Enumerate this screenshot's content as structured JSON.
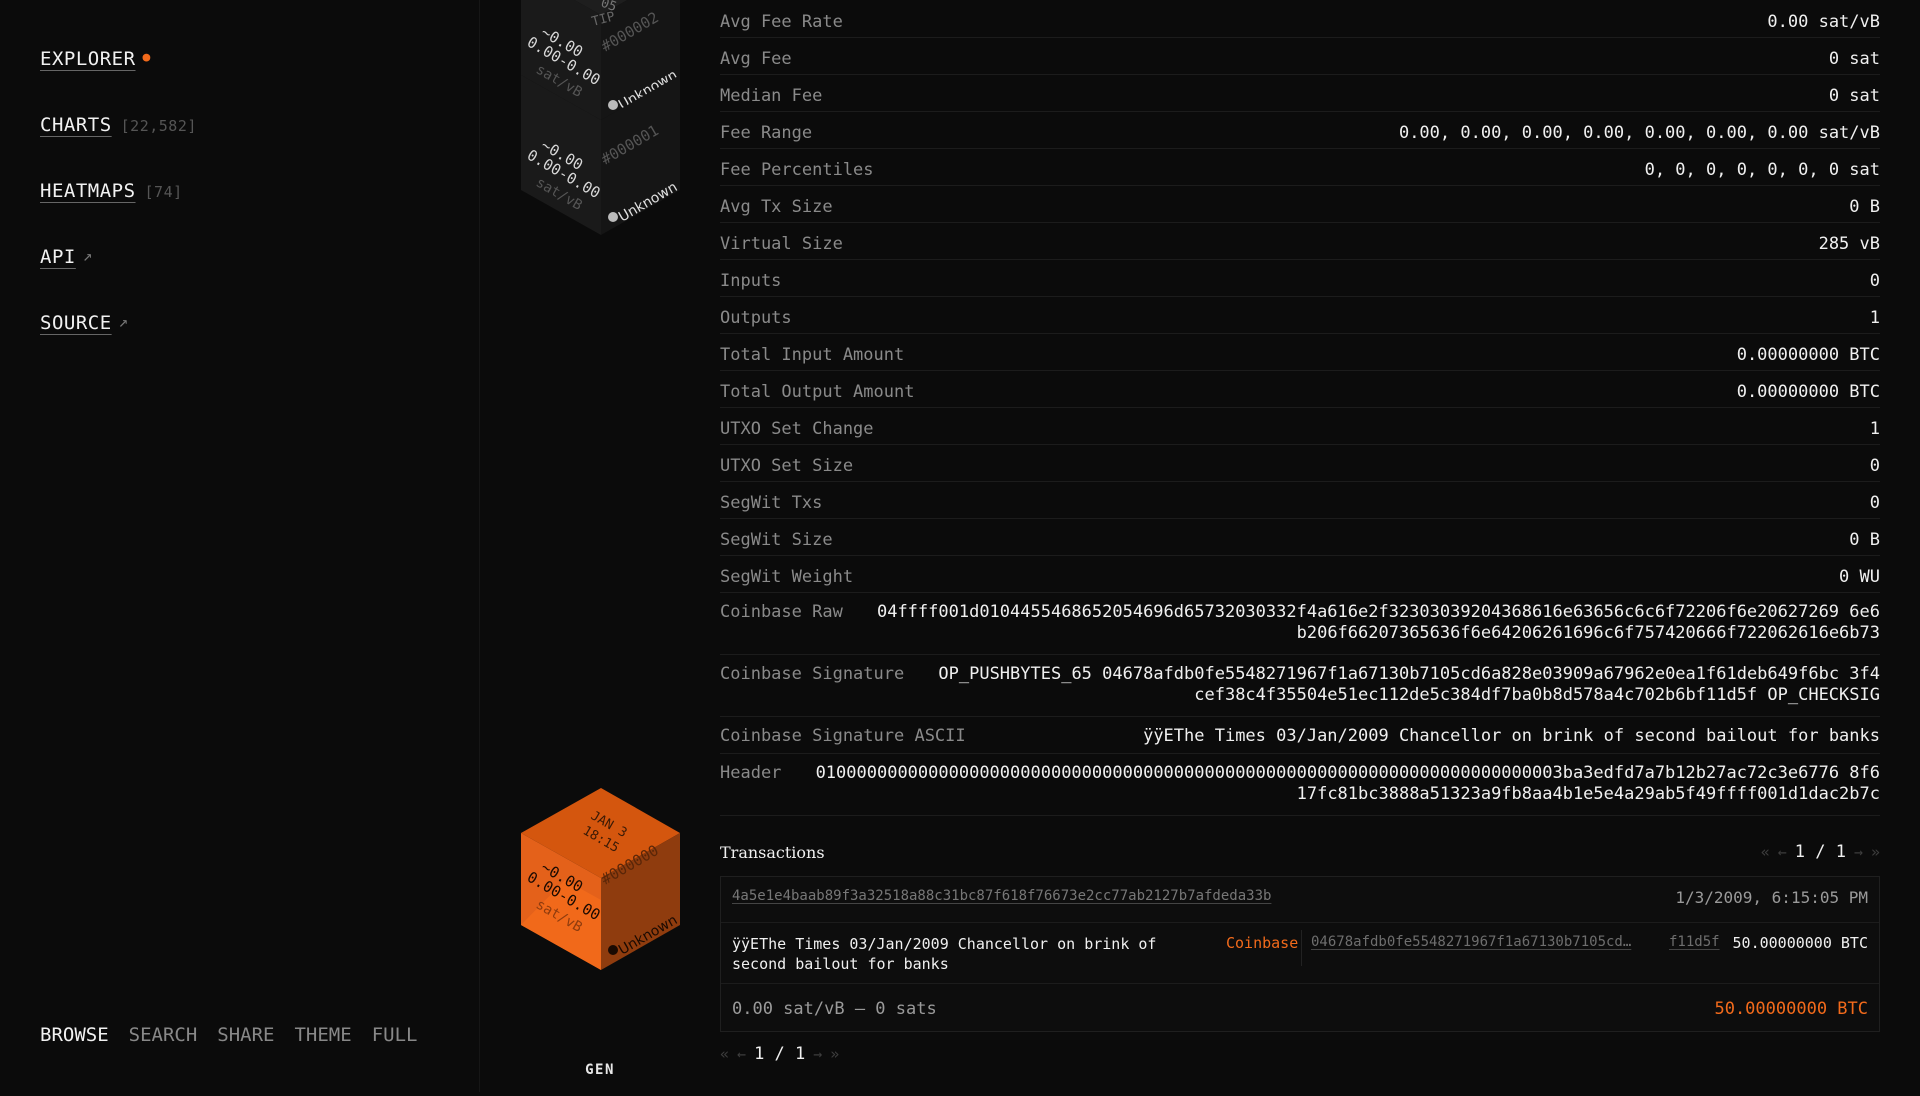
{
  "sidebar": {
    "nav": [
      {
        "label": "EXPLORER",
        "count": "",
        "marker": "dot"
      },
      {
        "label": "CHARTS",
        "count": "[22,582]",
        "marker": ""
      },
      {
        "label": "HEATMAPS",
        "count": "[74]",
        "marker": ""
      },
      {
        "label": "API",
        "count": "",
        "marker": "↗"
      },
      {
        "label": "SOURCE",
        "count": "",
        "marker": "↗"
      }
    ],
    "footer": [
      "BROWSE",
      "SEARCH",
      "SHARE",
      "THEME",
      "FULL"
    ],
    "active_color": "#f26a1b"
  },
  "blocks": {
    "top_cube_1": {
      "tip": "TIP",
      "number": "#000002",
      "fee1": "~0.00",
      "fee2": "0.00-0.00",
      "unit": "sat/vB",
      "miner": "Unknown",
      "partial": "05"
    },
    "top_cube_2": {
      "number": "#000001",
      "fee1": "~0.00",
      "fee2": "0.00-0.00",
      "unit": "sat/vB",
      "miner": "Unknown"
    },
    "genesis": {
      "date": "JAN 3",
      "time": "18:15",
      "number": "#000000",
      "fee1": "~0.00",
      "fee2": "0.00-0.00",
      "unit": "sat/vB",
      "miner": "Unknown"
    },
    "gen_label": "GEN",
    "accent": "#f26a1b"
  },
  "details": [
    {
      "k": "Avg Fee Rate",
      "v": "0.00 sat/vB"
    },
    {
      "k": "Avg Fee",
      "v": "0 sat"
    },
    {
      "k": "Median Fee",
      "v": "0 sat"
    },
    {
      "k": "Fee Range",
      "v": "0.00, 0.00, 0.00, 0.00, 0.00, 0.00, 0.00 sat/vB"
    },
    {
      "k": "Fee Percentiles",
      "v": "0, 0, 0, 0, 0, 0, 0 sat"
    },
    {
      "k": "Avg Tx Size",
      "v": "0 B"
    },
    {
      "k": "Virtual Size",
      "v": "285 vB"
    },
    {
      "k": "Inputs",
      "v": "0"
    },
    {
      "k": "Outputs",
      "v": "1"
    },
    {
      "k": "Total Input Amount",
      "v": "0.00000000 BTC"
    },
    {
      "k": "Total Output Amount",
      "v": "0.00000000 BTC"
    },
    {
      "k": "UTXO Set Change",
      "v": "1"
    },
    {
      "k": "UTXO Set Size",
      "v": "0"
    },
    {
      "k": "SegWit Txs",
      "v": "0"
    },
    {
      "k": "SegWit Size",
      "v": "0 B"
    },
    {
      "k": "SegWit Weight",
      "v": "0 WU"
    },
    {
      "k": "Coinbase Raw",
      "v": "04ffff001d0104455468652054696d65732030332f4a616e2f32303039204368616e63656c6c6f72206f6e20627269 6e6b206f66207365636f6e64206261696c6f757420666f722062616e6b73"
    },
    {
      "k": "Coinbase Signature",
      "v": "OP_PUSHBYTES_65 04678afdb0fe5548271967f1a67130b7105cd6a828e03909a67962e0ea1f61deb649f6bc 3f4cef38c4f35504e51ec112de5c384df7ba0b8d578a4c702b6bf11d5f OP_CHECKSIG"
    },
    {
      "k": "Coinbase Signature ASCII",
      "v": "ÿÿEThe Times 03/Jan/2009 Chancellor on brink of second bailout for banks"
    },
    {
      "k": "Header",
      "v": "0100000000000000000000000000000000000000000000000000000000000000000000003ba3edfd7a7b12b27ac72c3e6776 8f617fc81bc3888a51323a9fb8aa4b1e5e4a29ab5f49ffff001d1dac2b7c"
    }
  ],
  "transactions": {
    "title": "Transactions",
    "pager": {
      "first": "«",
      "prev": "←",
      "text": "1 / 1",
      "next": "→",
      "last": "»"
    },
    "items": [
      {
        "txid": "4a5e1e4baab89f3a32518a88c31bc87f618f76673e2cc77ab2127b7afdeda33b",
        "date": "1/3/2009, 6:15:05 PM",
        "input": "ÿÿEThe Times 03/Jan/2009 Chancellor on brink of second bailout for banks",
        "coinbase_label": "Coinbase",
        "address": "04678afdb0fe5548271967f1a67130b7105cd…",
        "address_tail": "f11d5f",
        "output_amount": "50.00000000 BTC",
        "fee": "0.00 sat/vB – 0 sats",
        "total": "50.00000000 BTC"
      }
    ],
    "bottom_pager": {
      "first": "«",
      "prev": "←",
      "text": "1 / 1",
      "next": "→",
      "last": "»"
    }
  }
}
